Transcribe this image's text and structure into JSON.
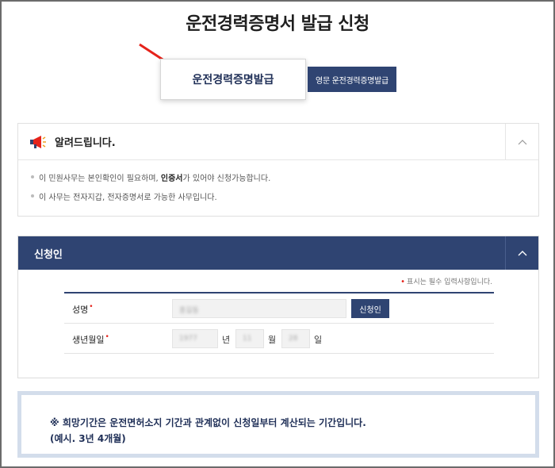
{
  "page": {
    "title": "운전경력증명서 발급 신청"
  },
  "tabs": [
    {
      "label": "운전경력증명발급",
      "active": true
    },
    {
      "label": "영문 운전경력증명발급",
      "active": false
    }
  ],
  "notice": {
    "title": "알려드립니다.",
    "item1_pre": "이 민원사무는 본인확인이 필요하며, ",
    "item1_bold": "인증서",
    "item1_post": "가 있어야 신청가능합니다.",
    "item2": "이 사무는 전자지갑, 전자증명서로 가능한 사무입니다."
  },
  "applicant": {
    "title": "신청인",
    "required_note": "표시는 필수 입력사항입니다.",
    "required_mark": "•",
    "name_label": "성명",
    "name_value": "홍길동",
    "cert_button": "신청인",
    "birth_label": "생년월일",
    "birth_year": "1977",
    "birth_month": "11",
    "birth_day": "28",
    "unit_year": "년",
    "unit_month": "월",
    "unit_day": "일"
  },
  "info": {
    "line1": "※ 희망기간은 운전면허소지 기간과 관계없이 신청일부터 계산되는 기간입니다.",
    "line2": "(예시. 3년 4개월)"
  },
  "colors": {
    "navy": "#2f4472",
    "required_red": "#e5231b",
    "arrow_red": "#e5231b",
    "info_border": "#d3ddeb"
  },
  "icons": {
    "notice": "megaphone-icon",
    "collapse": "chevron-up-icon"
  }
}
